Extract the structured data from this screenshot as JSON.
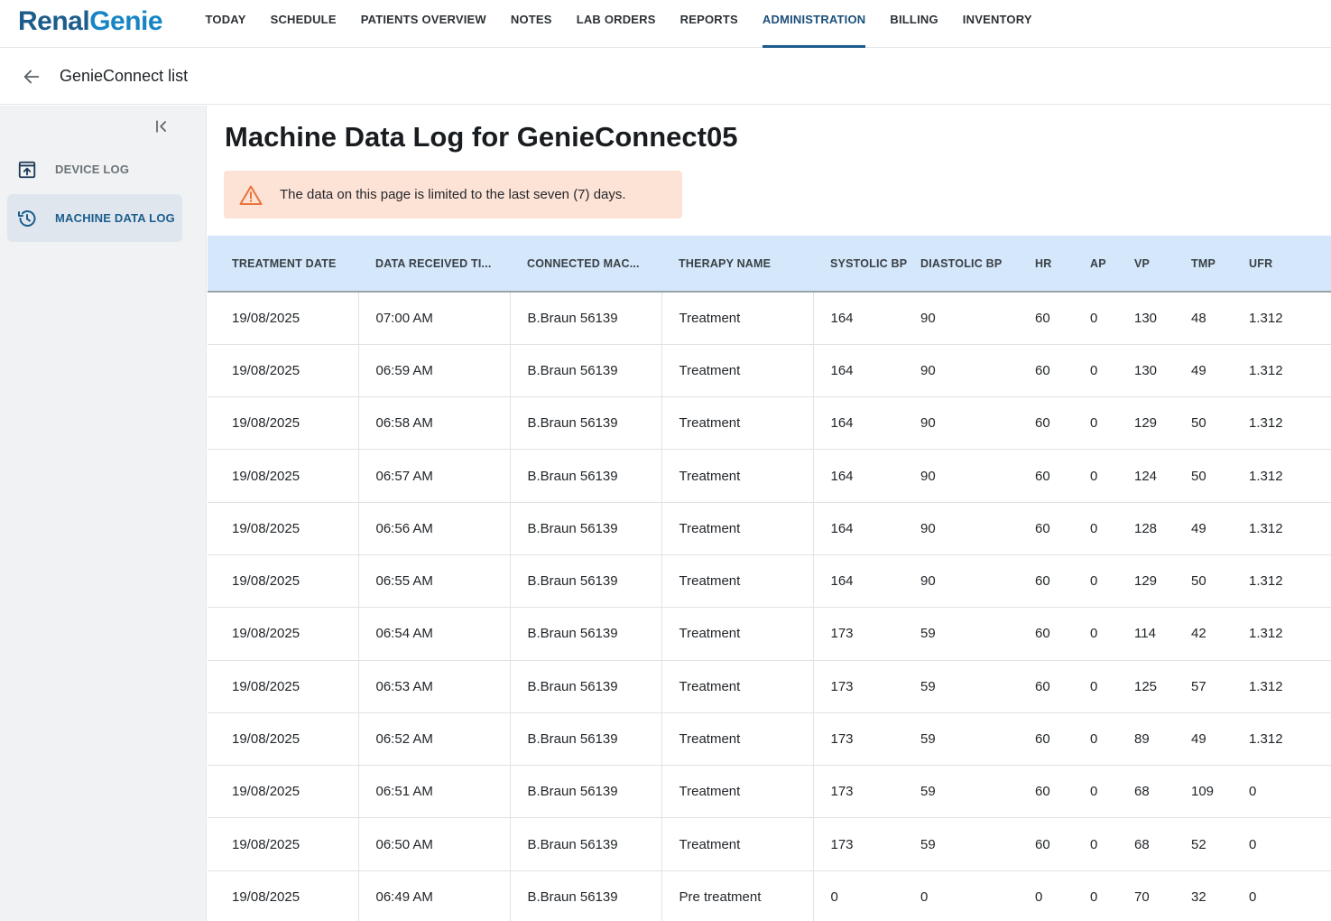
{
  "app": {
    "logo_part1": "Renal",
    "logo_part2": "Genie"
  },
  "nav": {
    "items": [
      {
        "label": "TODAY"
      },
      {
        "label": "SCHEDULE"
      },
      {
        "label": "PATIENTS OVERVIEW"
      },
      {
        "label": "NOTES"
      },
      {
        "label": "LAB ORDERS"
      },
      {
        "label": "REPORTS"
      },
      {
        "label": "ADMINISTRATION"
      },
      {
        "label": "BILLING"
      },
      {
        "label": "INVENTORY"
      }
    ],
    "active": "ADMINISTRATION"
  },
  "breadcrumb": {
    "back_icon": "arrow-left-icon",
    "title": "GenieConnect list"
  },
  "sidebar": {
    "collapse_icon": "collapse-left-icon",
    "items": [
      {
        "label": "DEVICE LOG",
        "icon": "device-upload-icon",
        "active": false
      },
      {
        "label": "MACHINE DATA LOG",
        "icon": "history-icon",
        "active": true
      }
    ]
  },
  "main": {
    "title": "Machine Data Log for GenieConnect05",
    "alert": {
      "icon": "warning-icon",
      "text": "The data on this page is limited to the last seven (7) days."
    },
    "table": {
      "columns": [
        "TREATMENT DATE",
        "DATA RECEIVED TI...",
        "CONNECTED MAC...",
        "THERAPY NAME",
        "SYSTOLIC BP",
        "DIASTOLIC BP",
        "HR",
        "AP",
        "VP",
        "TMP",
        "UFR"
      ],
      "rows": [
        [
          "19/08/2025",
          "07:00 AM",
          "B.Braun 56139",
          "Treatment",
          "164",
          "90",
          "60",
          "0",
          "130",
          "48",
          "1.312"
        ],
        [
          "19/08/2025",
          "06:59 AM",
          "B.Braun 56139",
          "Treatment",
          "164",
          "90",
          "60",
          "0",
          "130",
          "49",
          "1.312"
        ],
        [
          "19/08/2025",
          "06:58 AM",
          "B.Braun 56139",
          "Treatment",
          "164",
          "90",
          "60",
          "0",
          "129",
          "50",
          "1.312"
        ],
        [
          "19/08/2025",
          "06:57 AM",
          "B.Braun 56139",
          "Treatment",
          "164",
          "90",
          "60",
          "0",
          "124",
          "50",
          "1.312"
        ],
        [
          "19/08/2025",
          "06:56 AM",
          "B.Braun 56139",
          "Treatment",
          "164",
          "90",
          "60",
          "0",
          "128",
          "49",
          "1.312"
        ],
        [
          "19/08/2025",
          "06:55 AM",
          "B.Braun 56139",
          "Treatment",
          "164",
          "90",
          "60",
          "0",
          "129",
          "50",
          "1.312"
        ],
        [
          "19/08/2025",
          "06:54 AM",
          "B.Braun 56139",
          "Treatment",
          "173",
          "59",
          "60",
          "0",
          "114",
          "42",
          "1.312"
        ],
        [
          "19/08/2025",
          "06:53 AM",
          "B.Braun 56139",
          "Treatment",
          "173",
          "59",
          "60",
          "0",
          "125",
          "57",
          "1.312"
        ],
        [
          "19/08/2025",
          "06:52 AM",
          "B.Braun 56139",
          "Treatment",
          "173",
          "59",
          "60",
          "0",
          "89",
          "49",
          "1.312"
        ],
        [
          "19/08/2025",
          "06:51 AM",
          "B.Braun 56139",
          "Treatment",
          "173",
          "59",
          "60",
          "0",
          "68",
          "109",
          "0"
        ],
        [
          "19/08/2025",
          "06:50 AM",
          "B.Braun 56139",
          "Treatment",
          "173",
          "59",
          "60",
          "0",
          "68",
          "52",
          "0"
        ],
        [
          "19/08/2025",
          "06:49 AM",
          "B.Braun 56139",
          "Pre treatment",
          "0",
          "0",
          "0",
          "0",
          "70",
          "32",
          "0"
        ]
      ]
    }
  },
  "colors": {
    "brand_dark": "#1c5d8c",
    "brand_light": "#1784c5",
    "header_bg": "#d4e7fb",
    "alert_bg": "#fde2d6",
    "alert_icon": "#e8743b",
    "active_item_bg": "#dfe6ee"
  }
}
